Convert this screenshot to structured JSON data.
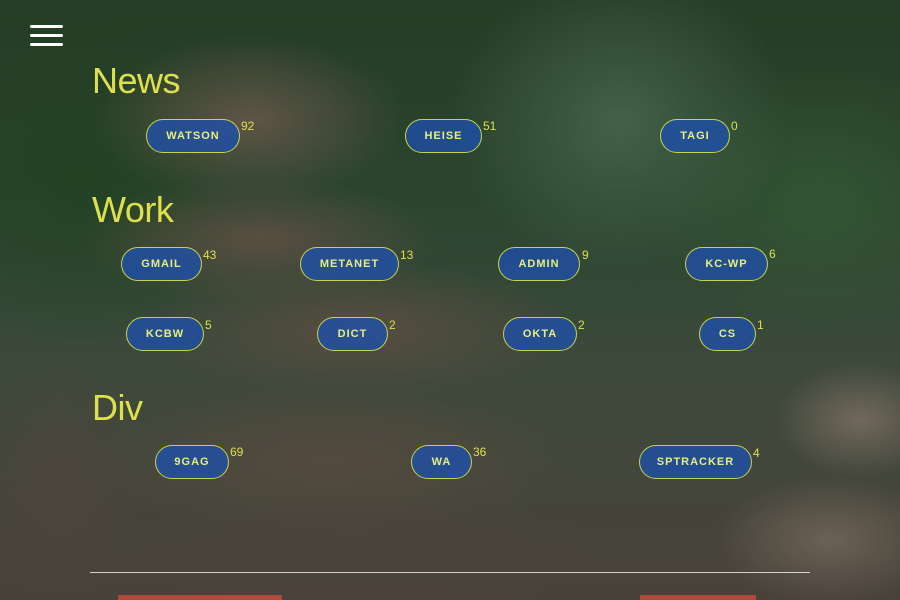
{
  "sections": [
    {
      "title": "News",
      "items": [
        {
          "label": "WATSON",
          "count": "92"
        },
        {
          "label": "HEISE",
          "count": "51"
        },
        {
          "label": "TAGI",
          "count": "0"
        }
      ]
    },
    {
      "title": "Work",
      "items": [
        {
          "label": "GMAIL",
          "count": "43"
        },
        {
          "label": "METANET",
          "count": "13"
        },
        {
          "label": "ADMIN",
          "count": "9"
        },
        {
          "label": "KC-WP",
          "count": "6"
        },
        {
          "label": "KCBW",
          "count": "5"
        },
        {
          "label": "DICT",
          "count": "2"
        },
        {
          "label": "OKTA",
          "count": "2"
        },
        {
          "label": "CS",
          "count": "1"
        }
      ]
    },
    {
      "title": "Div",
      "items": [
        {
          "label": "9GAG",
          "count": "69"
        },
        {
          "label": "WA",
          "count": "36"
        },
        {
          "label": "SPTRACKER",
          "count": "4"
        }
      ]
    }
  ],
  "colors": {
    "accent": "#dce04a",
    "pill_fill": "#1e50aa",
    "pill_border": "#c8d24e"
  },
  "icons": {
    "menu": "hamburger-menu-icon"
  }
}
